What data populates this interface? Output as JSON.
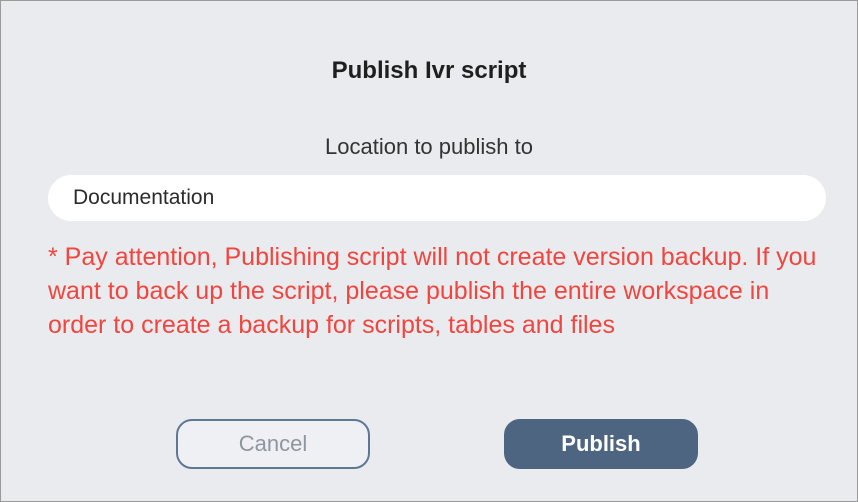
{
  "dialog": {
    "title": "Publish Ivr script",
    "location_label": "Location to publish to",
    "location_value": "Documentation",
    "warning_text": "* Pay attention, Publishing script will not create version backup. If you want to back up the script, please publish the entire workspace in order to create a backup for scripts, tables and files",
    "cancel_label": "Cancel",
    "publish_label": "Publish"
  },
  "colors": {
    "background": "#e9ebee",
    "warning": "#f0463f",
    "primary_button": "#4e6582",
    "cancel_border": "#5e7794"
  }
}
